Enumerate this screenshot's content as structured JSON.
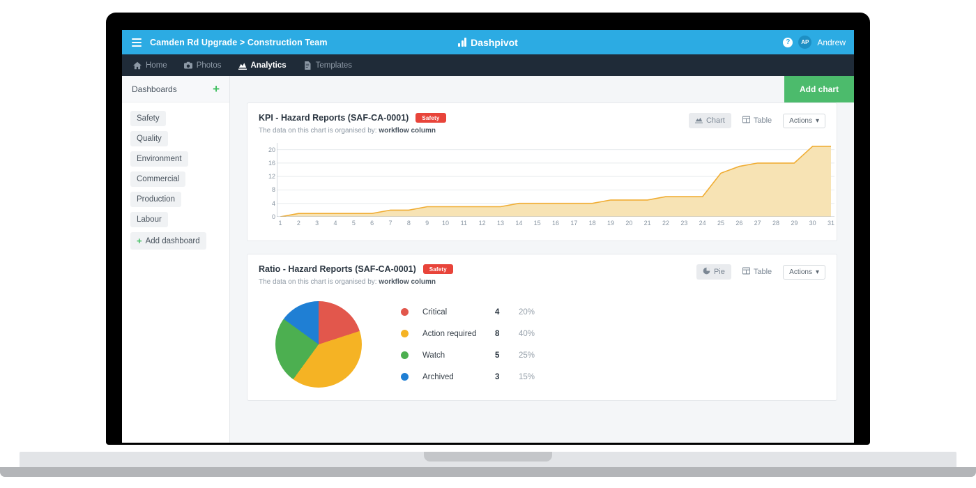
{
  "topbar": {
    "menu_icon": "hamburger-icon",
    "breadcrumb": "Camden Rd Upgrade > Construction Team",
    "brand_name": "Dashpivot",
    "brand_icon": "bar-chart-logo-icon",
    "help_icon": "question-mark-icon",
    "help_label": "?",
    "avatar_initials": "AP",
    "username": "Andrew",
    "bg_color": "#2cabe3"
  },
  "nav": {
    "items": [
      {
        "label": "Home",
        "icon": "home-icon",
        "active": false
      },
      {
        "label": "Photos",
        "icon": "camera-icon",
        "active": false
      },
      {
        "label": "Analytics",
        "icon": "chart-icon",
        "active": true
      },
      {
        "label": "Templates",
        "icon": "document-icon",
        "active": false
      }
    ],
    "bg_color": "#1f2b38"
  },
  "sidebar": {
    "title": "Dashboards",
    "add_icon": "plus-icon",
    "items": [
      {
        "label": "Safety"
      },
      {
        "label": "Quality"
      },
      {
        "label": "Environment"
      },
      {
        "label": "Commercial"
      },
      {
        "label": "Production"
      },
      {
        "label": "Labour"
      }
    ],
    "add_dashboard_label": "Add dashboard",
    "add_dashboard_icon": "plus-icon"
  },
  "main": {
    "add_chart_label": "Add chart",
    "add_chart_color": "#4cbb6c"
  },
  "cards": [
    {
      "title": "KPI - Hazard Reports (SAF-CA-0001)",
      "badge": "Safety",
      "badge_color": "#e8443a",
      "subtitle_prefix": "The data on this chart is organised by:",
      "subtitle_strong": "workflow column",
      "view_primary": "Chart",
      "view_primary_icon": "area-chart-icon",
      "view_secondary": "Table",
      "view_secondary_icon": "table-icon",
      "actions_label": "Actions",
      "actions_icon": "chevron-down-icon"
    },
    {
      "title": "Ratio - Hazard Reports (SAF-CA-0001)",
      "badge": "Safety",
      "badge_color": "#e8443a",
      "subtitle_prefix": "The data on this chart is organised by:",
      "subtitle_strong": "workflow column",
      "view_primary": "Pie",
      "view_primary_icon": "pie-chart-icon",
      "view_secondary": "Table",
      "view_secondary_icon": "table-icon",
      "actions_label": "Actions",
      "actions_icon": "chevron-down-icon"
    }
  ],
  "chart_data": [
    {
      "type": "area",
      "title": "KPI - Hazard Reports (SAF-CA-0001)",
      "xlabel": "",
      "ylabel": "",
      "x": [
        1,
        2,
        3,
        4,
        5,
        6,
        7,
        8,
        9,
        10,
        11,
        12,
        13,
        14,
        15,
        16,
        17,
        18,
        19,
        20,
        21,
        22,
        23,
        24,
        25,
        26,
        27,
        28,
        29,
        30,
        31
      ],
      "values": [
        0,
        1,
        1,
        1,
        1,
        1,
        2,
        2,
        3,
        3,
        3,
        3,
        3,
        4,
        4,
        4,
        4,
        4,
        5,
        5,
        5,
        6,
        6,
        6,
        13,
        15,
        16,
        16,
        16,
        21,
        21
      ],
      "ylim": [
        0,
        22
      ],
      "yticks": [
        0,
        4,
        8,
        12,
        16,
        20
      ],
      "xticks": [
        1,
        2,
        3,
        4,
        5,
        6,
        7,
        8,
        9,
        10,
        11,
        12,
        13,
        14,
        15,
        16,
        17,
        18,
        19,
        20,
        21,
        22,
        23,
        24,
        25,
        26,
        27,
        28,
        29,
        30,
        31
      ],
      "grid": true,
      "legend": "none",
      "line_color": "#f0ad34",
      "fill_color": "#f7e3b4"
    },
    {
      "type": "pie",
      "title": "Ratio - Hazard Reports (SAF-CA-0001)",
      "legend_position": "right",
      "labels": [
        "Critical",
        "Action required",
        "Watch",
        "Archived"
      ],
      "values": [
        4,
        8,
        5,
        3
      ],
      "percents": [
        "20%",
        "40%",
        "25%",
        "15%"
      ],
      "percent_values": [
        20,
        40,
        25,
        15
      ],
      "colors": [
        "#e2574c",
        "#f5b324",
        "#4caf50",
        "#1f7fd4"
      ]
    }
  ]
}
